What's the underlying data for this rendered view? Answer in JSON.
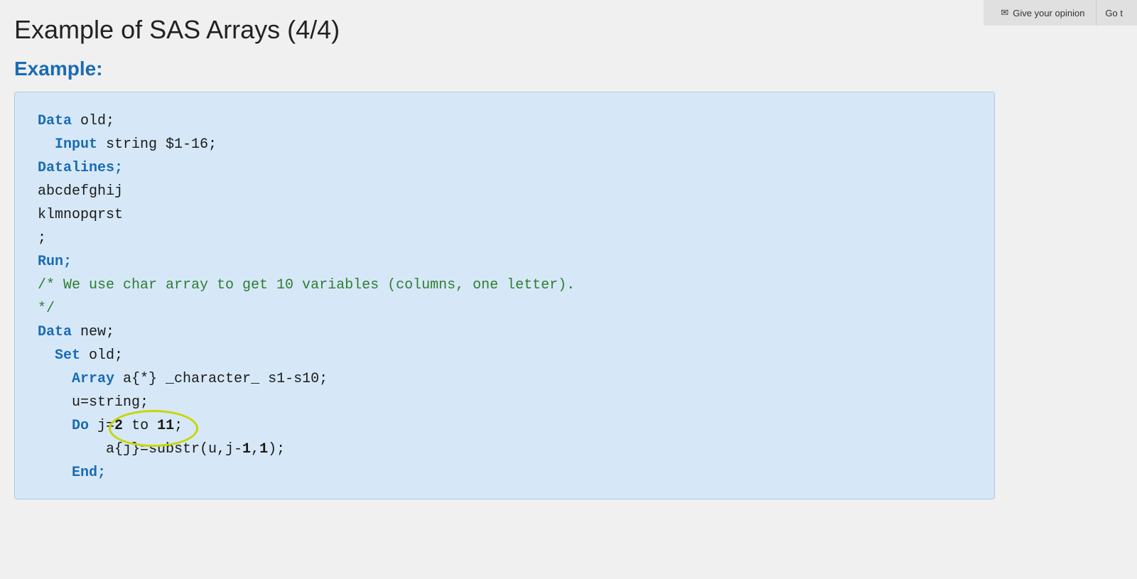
{
  "page": {
    "title": "Example of SAS Arrays (4/4)",
    "example_label": "Example:",
    "topbar": {
      "opinion_icon": "✉",
      "opinion_label": "Give your opinion",
      "go_label": "Go t"
    },
    "code": {
      "lines": [
        {
          "id": "line1",
          "type": "keyword_normal",
          "content": "Data old;"
        },
        {
          "id": "line2",
          "type": "indent_normal",
          "content": "  Input string $1-16;"
        },
        {
          "id": "line3",
          "type": "keyword_only",
          "content": "Datalines;"
        },
        {
          "id": "line4",
          "type": "normal",
          "content": "abcdefghij"
        },
        {
          "id": "line5",
          "type": "normal",
          "content": "klmnopqrst"
        },
        {
          "id": "line6",
          "type": "normal",
          "content": ";"
        },
        {
          "id": "line7",
          "type": "keyword_normal",
          "content": "Run;"
        },
        {
          "id": "line8",
          "type": "comment",
          "content": "/* We use char array to get 10 variables (columns, one letter)."
        },
        {
          "id": "line9",
          "type": "comment",
          "content": "*/"
        },
        {
          "id": "line10",
          "type": "keyword_normal",
          "content": "Data new;"
        },
        {
          "id": "line11",
          "type": "indent_keyword",
          "content": "  Set old;"
        },
        {
          "id": "line12",
          "type": "indent2_normal",
          "content": "    Array a{*} _character_ s1-s10;"
        },
        {
          "id": "line13",
          "type": "indent2_normal",
          "content": "    u=string;"
        },
        {
          "id": "line14",
          "type": "do_line",
          "content": "    Do j=2 to 11;"
        },
        {
          "id": "line15",
          "type": "indent3_normal",
          "content": "        a{j}=substr(u,j-1,1);"
        },
        {
          "id": "line16",
          "type": "indent2_normal",
          "content": "    End;"
        }
      ]
    }
  }
}
